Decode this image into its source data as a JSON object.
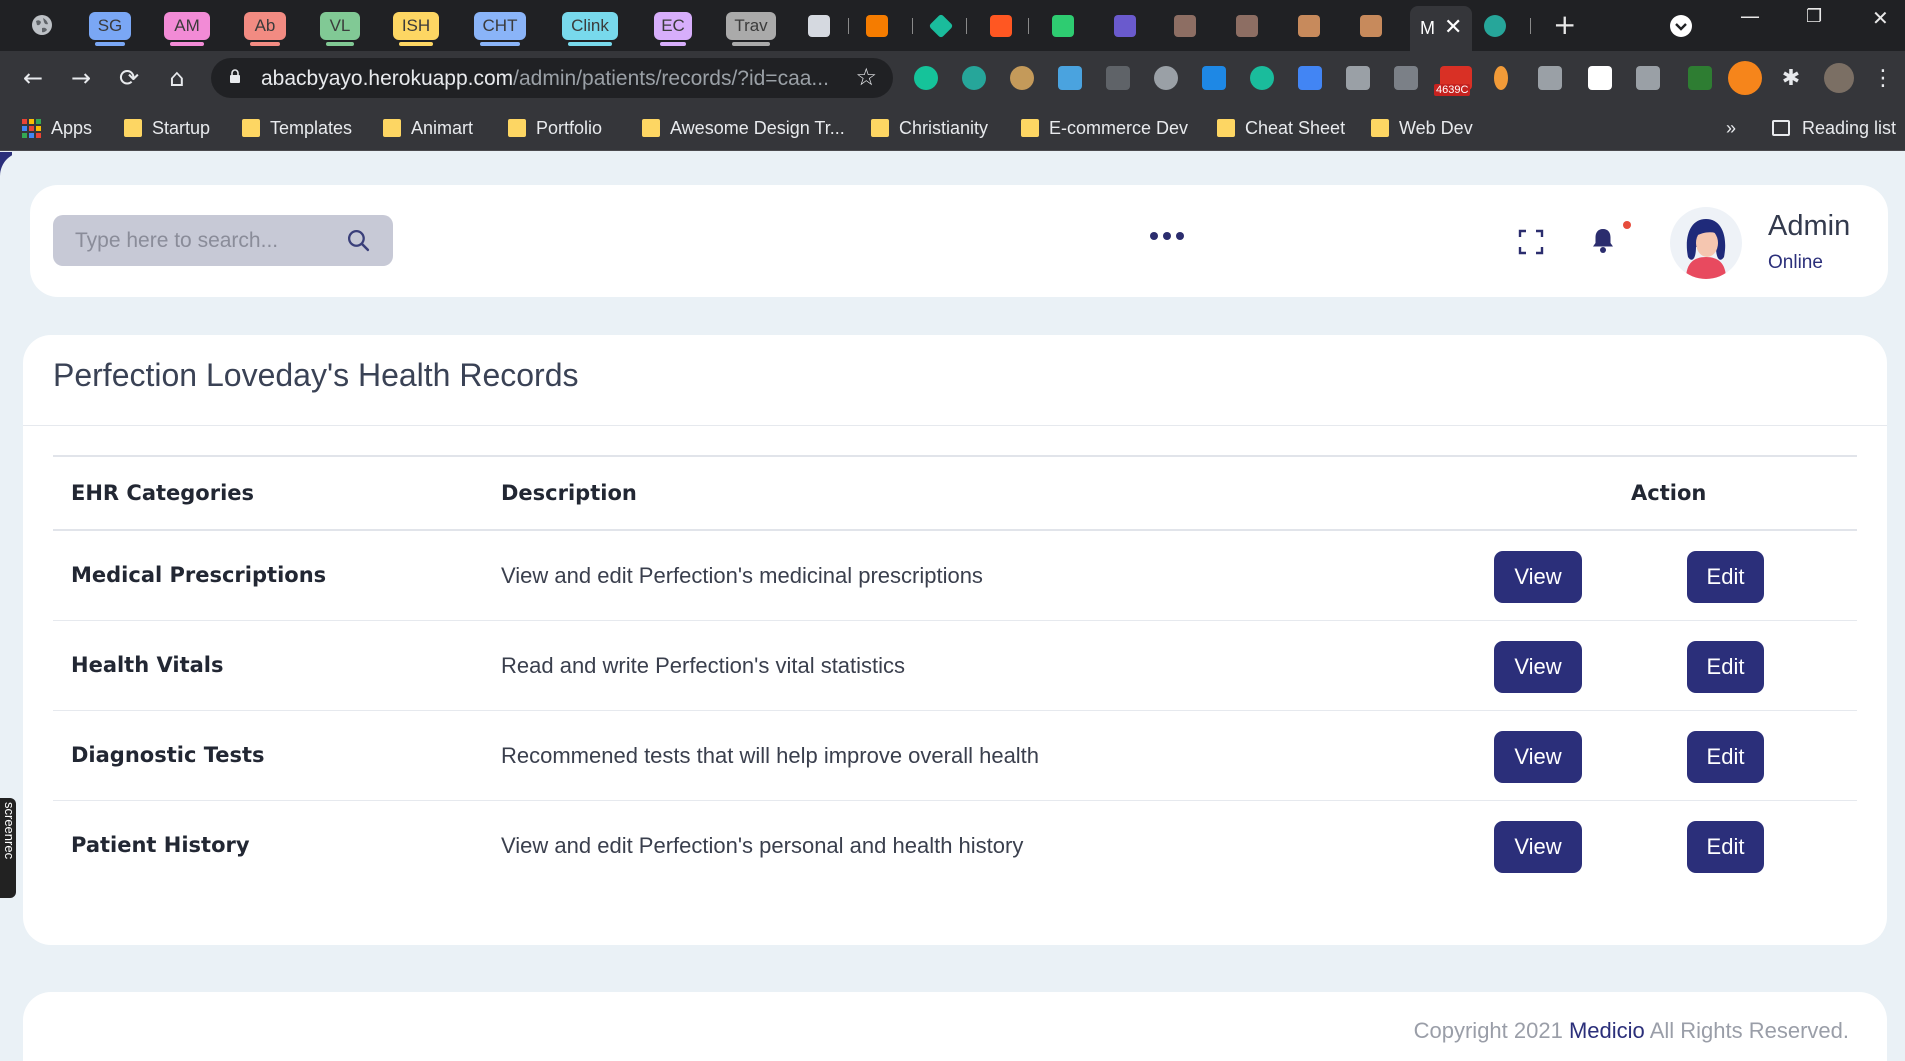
{
  "browser": {
    "tabs": [
      {
        "label": "SG",
        "color": "#7aa7f5"
      },
      {
        "label": "AM",
        "color": "#f28bd6"
      },
      {
        "label": "Ab",
        "color": "#f28b82"
      },
      {
        "label": "VL",
        "color": "#81c995"
      },
      {
        "label": "ISH",
        "color": "#fdd663"
      },
      {
        "label": "CHT",
        "color": "#8ab4f8"
      },
      {
        "label": "Clink",
        "color": "#78d9ec"
      },
      {
        "label": "EC",
        "color": "#d7aefb"
      },
      {
        "label": "Trav",
        "color": "#aaaaaa"
      }
    ],
    "active_tab_letter": "M",
    "url_host": "abacbyayo.herokuapp.com",
    "url_path": "/admin/patients/records/?id=caa...",
    "extension_badge": "4639C",
    "bookmarks": {
      "apps": "Apps",
      "items": [
        "Startup",
        "Templates",
        "Animart",
        "Portfolio",
        "Awesome Design Tr...",
        "Christianity",
        "E-commerce Dev",
        "Cheat Sheet",
        "Web Dev"
      ],
      "overflow": "»",
      "reading_list": "Reading list"
    }
  },
  "header": {
    "search_placeholder": "Type here to search...",
    "admin_name": "Admin",
    "admin_status": "Online"
  },
  "records": {
    "title": "Perfection Loveday's Health Records",
    "columns": {
      "category": "EHR Categories",
      "description": "Description",
      "action": "Action"
    },
    "rows": [
      {
        "category": "Medical Prescriptions",
        "description": "View and edit Perfection's medicinal prescriptions",
        "view": "View",
        "edit": "Edit"
      },
      {
        "category": "Health Vitals",
        "description": "Read and write Perfection's vital statistics",
        "view": "View",
        "edit": "Edit"
      },
      {
        "category": "Diagnostic Tests",
        "description": "Recommened tests that will help improve overall health",
        "view": "View",
        "edit": "Edit"
      },
      {
        "category": "Patient History",
        "description": "View and edit Perfection's personal and health history",
        "view": "View",
        "edit": "Edit"
      }
    ]
  },
  "footer": {
    "prefix": "Copyright 2021",
    "brand": "Medicio",
    "suffix": "All Rights Reserved."
  },
  "overlay": {
    "screenrec": "screenrec"
  },
  "colors": {
    "primary": "#2b2f7a",
    "background": "#eaf1f6",
    "card": "#ffffff",
    "notification_dot": "#e74c3c"
  }
}
